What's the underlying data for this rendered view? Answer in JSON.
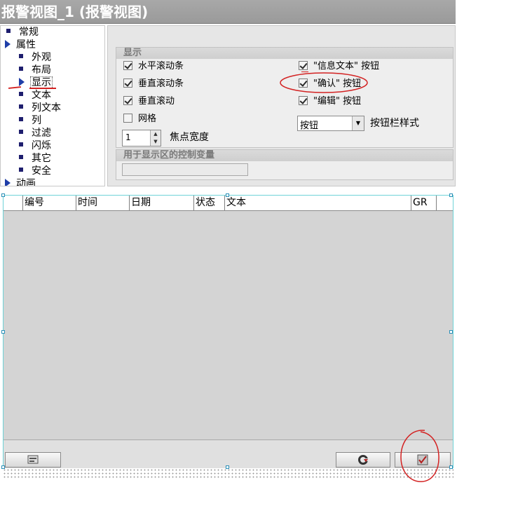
{
  "title": "报警视图_1 (报警视图)",
  "tree": [
    {
      "label": "常规",
      "kind": "bullet",
      "level": 0
    },
    {
      "label": "属性",
      "kind": "arrow",
      "level": 0
    },
    {
      "label": "外观",
      "kind": "bullet",
      "level": 1
    },
    {
      "label": "布局",
      "kind": "bullet",
      "level": 1
    },
    {
      "label": "显示",
      "kind": "arrow",
      "level": 1,
      "selected": true
    },
    {
      "label": "文本",
      "kind": "bullet",
      "level": 1
    },
    {
      "label": "列文本",
      "kind": "bullet",
      "level": 1
    },
    {
      "label": "列",
      "kind": "bullet",
      "level": 1
    },
    {
      "label": "过滤",
      "kind": "bullet",
      "level": 1
    },
    {
      "label": "闪烁",
      "kind": "bullet",
      "level": 1
    },
    {
      "label": "其它",
      "kind": "bullet",
      "level": 1
    },
    {
      "label": "安全",
      "kind": "bullet",
      "level": 1
    },
    {
      "label": "动画",
      "kind": "arrow",
      "level": 0
    }
  ],
  "display_group": {
    "title": "显示",
    "left_options": [
      {
        "label": "水平滚动条",
        "checked": true
      },
      {
        "label": "垂直滚动条",
        "checked": true
      },
      {
        "label": "垂直滚动",
        "checked": true
      },
      {
        "label": "网格",
        "checked": false
      }
    ],
    "right_options": [
      {
        "label": "\"信息文本\" 按钮",
        "checked": true
      },
      {
        "label": "\"确认\" 按钮",
        "checked": true
      },
      {
        "label": "\"编辑\" 按钮",
        "checked": true
      }
    ],
    "focus_width_value": "1",
    "focus_width_label": "焦点宽度",
    "button_bar_style_value": "按钮",
    "button_bar_style_label": "按钮栏样式"
  },
  "control_var_group": {
    "title": "用于显示区的控制变量",
    "value": ""
  },
  "alarm_columns": [
    "编号",
    "时间",
    "日期",
    "状态",
    "文本",
    "GR"
  ],
  "icons": {
    "tree_bullet": "square-bullet-icon",
    "tree_arrow": "expand-arrow-icon",
    "info_button": "info-text-icon",
    "loop_button": "loop-in-alarm-icon",
    "ack_button": "acknowledge-icon"
  },
  "colors": {
    "title_bg": "#9a9a9a",
    "annotation": "#d32222",
    "selection_frame": "#6fd3d7"
  }
}
